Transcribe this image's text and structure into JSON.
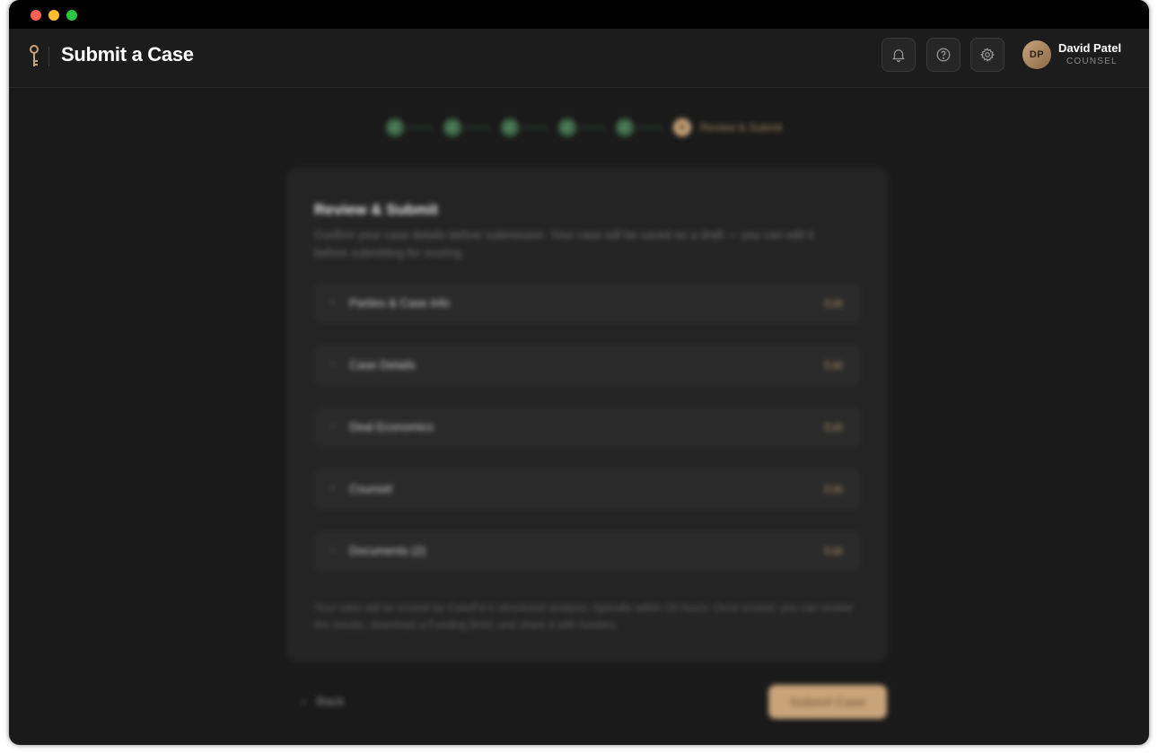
{
  "header": {
    "title": "Submit a Case",
    "icons": [
      "bell-icon",
      "help-icon",
      "gear-icon"
    ],
    "user": {
      "initials": "DP",
      "name": "David Patel",
      "role": "COUNSEL"
    }
  },
  "stepper": {
    "completed_steps": 5,
    "active_step_number": "6",
    "active_step_label": "Review & Submit"
  },
  "review": {
    "title": "Review & Submit",
    "description": "Confirm your case details before submission. Your case will be saved as a draft — you can edit it before submitting for scoring.",
    "sections": [
      {
        "label": "Parties & Case Info",
        "edit": "Edit"
      },
      {
        "label": "Case Details",
        "edit": "Edit"
      },
      {
        "label": "Deal Economics",
        "edit": "Edit"
      },
      {
        "label": "Counsel",
        "edit": "Edit"
      },
      {
        "label": "Documents (2)",
        "edit": "Edit"
      }
    ],
    "note": "Your case will be scored by CaseFin's structured analysis, typically within 24 hours. Once scored, you can review the results, download a Funding Brief, and share it with funders."
  },
  "footer": {
    "back_label": "Back",
    "submit_label": "Submit Case"
  },
  "colors": {
    "accent": "#c9a47a",
    "success": "#3f6b48",
    "background": "#1a1a1a"
  }
}
